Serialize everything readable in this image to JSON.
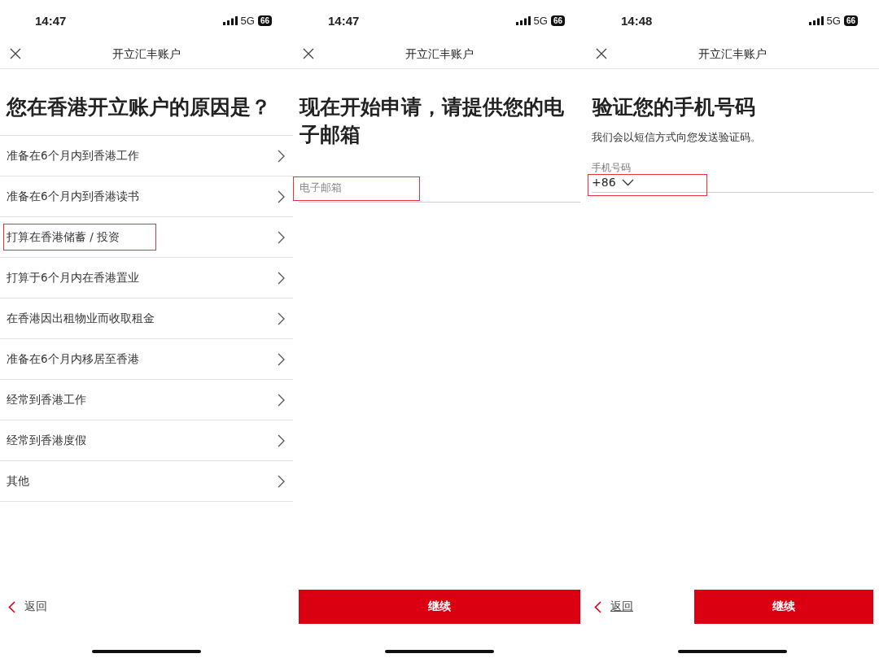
{
  "screens": [
    {
      "status_bar": {
        "time": "14:47",
        "network": "5G",
        "battery": "66"
      },
      "header": {
        "title": "开立汇丰账户"
      },
      "heading": "您在香港开立账户的原因是？",
      "options": [
        {
          "label": "准备在6个月内到香港工作",
          "highlighted": false
        },
        {
          "label": "准备在6个月内到香港读书",
          "highlighted": false
        },
        {
          "label": "打算在香港储蓄 / 投资",
          "highlighted": true
        },
        {
          "label": "打算于6个月内在香港置业",
          "highlighted": false
        },
        {
          "label": "在香港因出租物业而收取租金",
          "highlighted": false
        },
        {
          "label": "准备在6个月内移居至香港",
          "highlighted": false
        },
        {
          "label": "经常到香港工作",
          "highlighted": false
        },
        {
          "label": "经常到香港度假",
          "highlighted": false
        },
        {
          "label": "其他",
          "highlighted": false
        }
      ],
      "back": {
        "label": "返回",
        "underlined": false
      }
    },
    {
      "status_bar": {
        "time": "14:47",
        "network": "5G",
        "battery": "66"
      },
      "header": {
        "title": "开立汇丰账户"
      },
      "heading": "现在开始申请，请提供您的电子邮箱",
      "field": {
        "placeholder": "电子邮箱",
        "highlighted": true
      },
      "continue": {
        "label": "继续"
      }
    },
    {
      "status_bar": {
        "time": "14:48",
        "network": "5G",
        "battery": "66"
      },
      "header": {
        "title": "开立汇丰账户"
      },
      "heading": "验证您的手机号码",
      "subtitle": "我们会以短信方式向您发送验证码。",
      "field": {
        "label": "手机号码",
        "value": "+86",
        "highlighted": true
      },
      "back": {
        "label": "返回",
        "underlined": true
      },
      "continue": {
        "label": "继续"
      }
    }
  ]
}
